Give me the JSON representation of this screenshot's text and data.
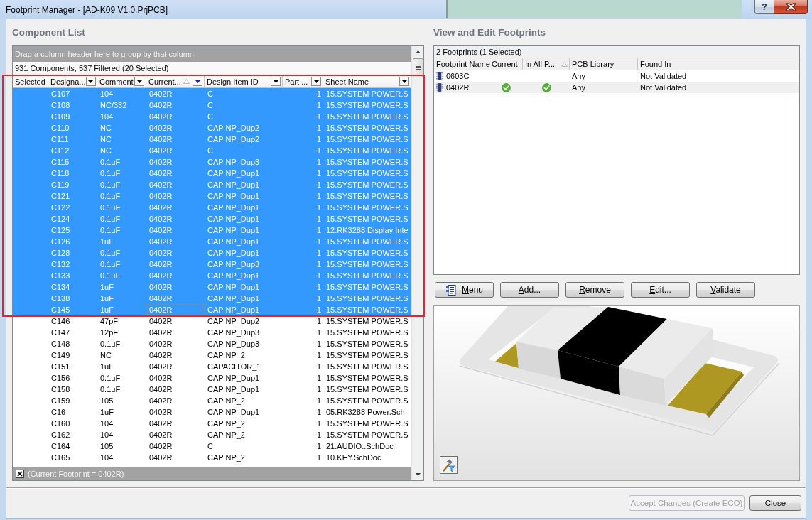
{
  "window": {
    "title": "Footprint Manager - [AD-K09 V1.0.PrjPCB]",
    "caption_buttons": [
      {
        "kind": "help",
        "label": "?"
      },
      {
        "kind": "close"
      }
    ]
  },
  "component_list": {
    "title": "Component List",
    "group_hint": "Drag a column header here to group by that column",
    "summary": "931 Components, 537 Filtered (20 Selected)",
    "columns": [
      {
        "label": "Selected",
        "filter_button": false,
        "sorted": false
      },
      {
        "label": "Designa...",
        "filter_button": true,
        "filtered": false,
        "sorted": false
      },
      {
        "label": "Comment",
        "filter_button": true,
        "filtered": false,
        "sorted": false
      },
      {
        "label": "Current...",
        "filter_button": true,
        "filtered": true,
        "sorted": true
      },
      {
        "label": "Design Item ID",
        "filter_button": true,
        "filtered": false,
        "sorted": false
      },
      {
        "label": "Part ...",
        "filter_button": true,
        "filtered": false,
        "sorted": false
      },
      {
        "label": "Sheet Name",
        "filter_button": true,
        "filtered": false,
        "sorted": false
      }
    ],
    "rows": [
      {
        "designator": "C107",
        "comment": "104",
        "current_footprint": "0402R",
        "design_item_id": "C",
        "part": "1",
        "sheet_name": "15.SYSTEM POWER.S",
        "selected": true,
        "focused": false
      },
      {
        "designator": "C108",
        "comment": "NC/332",
        "current_footprint": "0402R",
        "design_item_id": "C",
        "part": "1",
        "sheet_name": "15.SYSTEM POWER.S",
        "selected": true,
        "focused": false
      },
      {
        "designator": "C109",
        "comment": "104",
        "current_footprint": "0402R",
        "design_item_id": "C",
        "part": "1",
        "sheet_name": "15.SYSTEM POWER.S",
        "selected": true,
        "focused": false
      },
      {
        "designator": "C110",
        "comment": "NC",
        "current_footprint": "0402R",
        "design_item_id": "CAP NP_Dup2",
        "part": "1",
        "sheet_name": "15.SYSTEM POWER.S",
        "selected": true,
        "focused": false
      },
      {
        "designator": "C111",
        "comment": "NC",
        "current_footprint": "0402R",
        "design_item_id": "CAP NP_Dup2",
        "part": "1",
        "sheet_name": "15.SYSTEM POWER.S",
        "selected": true,
        "focused": false
      },
      {
        "designator": "C112",
        "comment": "NC",
        "current_footprint": "0402R",
        "design_item_id": "C",
        "part": "1",
        "sheet_name": "15.SYSTEM POWER.S",
        "selected": true,
        "focused": false
      },
      {
        "designator": "C115",
        "comment": "0.1uF",
        "current_footprint": "0402R",
        "design_item_id": "CAP NP_Dup3",
        "part": "1",
        "sheet_name": "15.SYSTEM POWER.S",
        "selected": true,
        "focused": false
      },
      {
        "designator": "C118",
        "comment": "0.1uF",
        "current_footprint": "0402R",
        "design_item_id": "CAP NP_Dup1",
        "part": "1",
        "sheet_name": "15.SYSTEM POWER.S",
        "selected": true,
        "focused": false
      },
      {
        "designator": "C119",
        "comment": "0.1uF",
        "current_footprint": "0402R",
        "design_item_id": "CAP NP_Dup1",
        "part": "1",
        "sheet_name": "15.SYSTEM POWER.S",
        "selected": true,
        "focused": false
      },
      {
        "designator": "C121",
        "comment": "0.1uF",
        "current_footprint": "0402R",
        "design_item_id": "CAP NP_Dup1",
        "part": "1",
        "sheet_name": "15.SYSTEM POWER.S",
        "selected": true,
        "focused": false
      },
      {
        "designator": "C122",
        "comment": "0.1uF",
        "current_footprint": "0402R",
        "design_item_id": "CAP NP_Dup1",
        "part": "1",
        "sheet_name": "15.SYSTEM POWER.S",
        "selected": true,
        "focused": false
      },
      {
        "designator": "C124",
        "comment": "0.1uF",
        "current_footprint": "0402R",
        "design_item_id": "CAP NP_Dup1",
        "part": "1",
        "sheet_name": "15.SYSTEM POWER.S",
        "selected": true,
        "focused": false
      },
      {
        "designator": "C125",
        "comment": "0.1uF",
        "current_footprint": "0402R",
        "design_item_id": "CAP NP_Dup1",
        "part": "1",
        "sheet_name": "12.RK3288 Display Inte",
        "selected": true,
        "focused": false
      },
      {
        "designator": "C126",
        "comment": "1uF",
        "current_footprint": "0402R",
        "design_item_id": "CAP NP_Dup1",
        "part": "1",
        "sheet_name": "15.SYSTEM POWER.S",
        "selected": true,
        "focused": false
      },
      {
        "designator": "C128",
        "comment": "0.1uF",
        "current_footprint": "0402R",
        "design_item_id": "CAP NP_Dup1",
        "part": "1",
        "sheet_name": "15.SYSTEM POWER.S",
        "selected": true,
        "focused": false
      },
      {
        "designator": "C132",
        "comment": "0.1uF",
        "current_footprint": "0402R",
        "design_item_id": "CAP NP_Dup3",
        "part": "1",
        "sheet_name": "15.SYSTEM POWER.S",
        "selected": true,
        "focused": false
      },
      {
        "designator": "C133",
        "comment": "0.1uF",
        "current_footprint": "0402R",
        "design_item_id": "CAP NP_Dup1",
        "part": "1",
        "sheet_name": "15.SYSTEM POWER.S",
        "selected": true,
        "focused": false
      },
      {
        "designator": "C134",
        "comment": "1uF",
        "current_footprint": "0402R",
        "design_item_id": "CAP NP_Dup1",
        "part": "1",
        "sheet_name": "15.SYSTEM POWER.S",
        "selected": true,
        "focused": false
      },
      {
        "designator": "C138",
        "comment": "1uF",
        "current_footprint": "0402R",
        "design_item_id": "CAP NP_Dup1",
        "part": "1",
        "sheet_name": "15.SYSTEM POWER.S",
        "selected": true,
        "focused": false
      },
      {
        "designator": "C145",
        "comment": "1uF",
        "current_footprint": "0402R",
        "design_item_id": "CAP NP_Dup1",
        "part": "1",
        "sheet_name": "15.SYSTEM POWER.S",
        "selected": true,
        "focused": true
      },
      {
        "designator": "C146",
        "comment": "47pF",
        "current_footprint": "0402R",
        "design_item_id": "CAP NP_Dup2",
        "part": "1",
        "sheet_name": "15.SYSTEM POWER.S",
        "selected": false,
        "focused": false
      },
      {
        "designator": "C147",
        "comment": "12pF",
        "current_footprint": "0402R",
        "design_item_id": "CAP NP_Dup3",
        "part": "1",
        "sheet_name": "15.SYSTEM POWER.S",
        "selected": false,
        "focused": false
      },
      {
        "designator": "C148",
        "comment": "0.1uF",
        "current_footprint": "0402R",
        "design_item_id": "CAP NP_Dup3",
        "part": "1",
        "sheet_name": "15.SYSTEM POWER.S",
        "selected": false,
        "focused": false
      },
      {
        "designator": "C149",
        "comment": "NC",
        "current_footprint": "0402R",
        "design_item_id": "CAP NP_2",
        "part": "1",
        "sheet_name": "15.SYSTEM POWER.S",
        "selected": false,
        "focused": false
      },
      {
        "designator": "C151",
        "comment": "1uF",
        "current_footprint": "0402R",
        "design_item_id": "CAPACITOR_1",
        "part": "1",
        "sheet_name": "15.SYSTEM POWER.S",
        "selected": false,
        "focused": false
      },
      {
        "designator": "C156",
        "comment": "0.1uF",
        "current_footprint": "0402R",
        "design_item_id": "CAP NP_Dup1",
        "part": "1",
        "sheet_name": "15.SYSTEM POWER.S",
        "selected": false,
        "focused": false
      },
      {
        "designator": "C158",
        "comment": "0.1uF",
        "current_footprint": "0402R",
        "design_item_id": "CAP NP_Dup1",
        "part": "1",
        "sheet_name": "15.SYSTEM POWER.S",
        "selected": false,
        "focused": false
      },
      {
        "designator": "C159",
        "comment": "105",
        "current_footprint": "0402R",
        "design_item_id": "CAP NP_2",
        "part": "1",
        "sheet_name": "15.SYSTEM POWER.S",
        "selected": false,
        "focused": false
      },
      {
        "designator": "C16",
        "comment": "1uF",
        "current_footprint": "0402R",
        "design_item_id": "CAP NP_Dup1",
        "part": "1",
        "sheet_name": "05.RK3288 Power.Sch",
        "selected": false,
        "focused": false
      },
      {
        "designator": "C160",
        "comment": "104",
        "current_footprint": "0402R",
        "design_item_id": "CAP NP_2",
        "part": "1",
        "sheet_name": "15.SYSTEM POWER.S",
        "selected": false,
        "focused": false
      },
      {
        "designator": "C162",
        "comment": "104",
        "current_footprint": "0402R",
        "design_item_id": "CAP NP_2",
        "part": "1",
        "sheet_name": "15.SYSTEM POWER.S",
        "selected": false,
        "focused": false
      },
      {
        "designator": "C164",
        "comment": "105",
        "current_footprint": "0402R",
        "design_item_id": "C",
        "part": "1",
        "sheet_name": "21.AUDIO..SchDoc",
        "selected": false,
        "focused": false
      },
      {
        "designator": "C165",
        "comment": "104",
        "current_footprint": "0402R",
        "design_item_id": "CAP NP_2",
        "part": "1",
        "sheet_name": "10.KEY.SchDoc",
        "selected": false,
        "focused": false
      }
    ],
    "filter_bar": {
      "text": "(Current Footprint = 0402R)"
    }
  },
  "annotation": {
    "kind": "outline"
  },
  "footprints": {
    "title": "View and Edit Footprints",
    "summary": "2 Footprints (1 Selected)",
    "columns": [
      {
        "label": "Footprint Name",
        "sorted": false
      },
      {
        "label": "Current",
        "sorted": false
      },
      {
        "label": "In All P...",
        "sorted": true
      },
      {
        "label": "PCB Library",
        "sorted": false
      },
      {
        "label": "Found In",
        "sorted": false
      }
    ],
    "rows": [
      {
        "name": "0603C",
        "current": false,
        "in_all_parts": false,
        "pcb_library": "Any",
        "found_in": "Not Validated",
        "selected": false
      },
      {
        "name": "0402R",
        "current": true,
        "in_all_parts": true,
        "pcb_library": "Any",
        "found_in": "Not Validated",
        "selected": true
      }
    ]
  },
  "actions": [
    {
      "label": "Menu",
      "kind": "menu"
    },
    {
      "label": "Add...",
      "kind": "plain"
    },
    {
      "label": "Remove",
      "kind": "plain"
    },
    {
      "label": "Edit...",
      "kind": "plain"
    },
    {
      "label": "Validate",
      "kind": "plain"
    }
  ],
  "dialog_buttons": [
    {
      "label": "Accept Changes (Create ECO)",
      "disabled": true
    },
    {
      "label": "Close",
      "disabled": false
    }
  ]
}
